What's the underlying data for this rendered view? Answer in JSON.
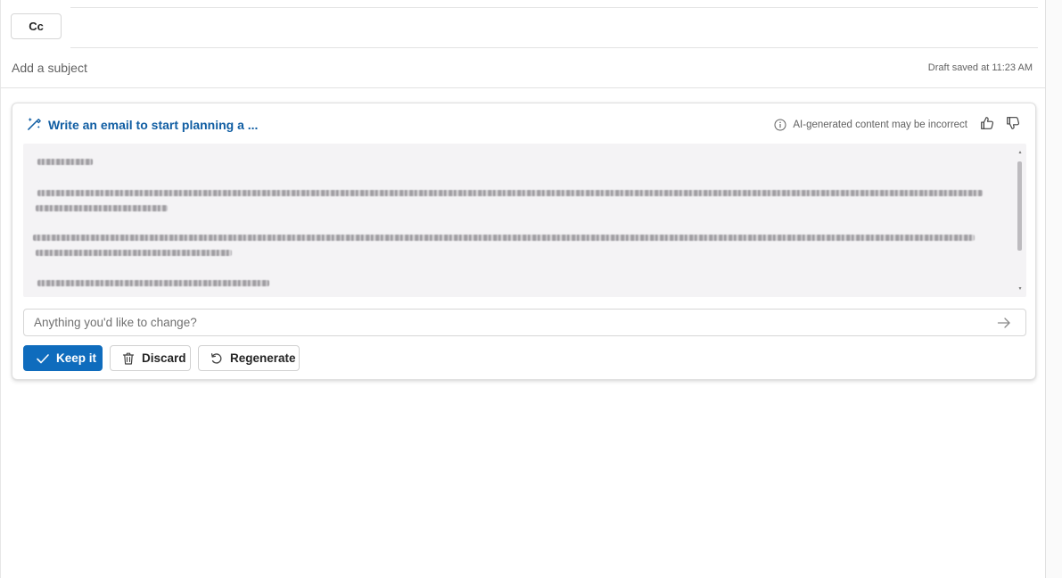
{
  "compose": {
    "cc_label": "Cc",
    "subject_placeholder": "Add a subject",
    "draft_status": "Draft saved at 11:23 AM"
  },
  "copilot": {
    "title": "Write an email to start planning a ...",
    "disclaimer": "AI-generated content may be incorrect",
    "refine_placeholder": "Anything you'd like to change?",
    "actions": {
      "keep": "Keep it",
      "discard": "Discard",
      "regenerate": "Regenerate"
    },
    "icons": {
      "title": "pen-sparkle-icon",
      "info": "info-icon",
      "like": "thumbs-up-icon",
      "dislike": "thumbs-down-icon",
      "send": "arrow-right-icon",
      "keep": "checkmark-icon",
      "discard": "trash-icon",
      "regenerate": "refresh-icon"
    }
  },
  "colors": {
    "accent": "#0f6cbd",
    "title_link": "#115ea3",
    "generated_bg": "#f4f3f5"
  }
}
